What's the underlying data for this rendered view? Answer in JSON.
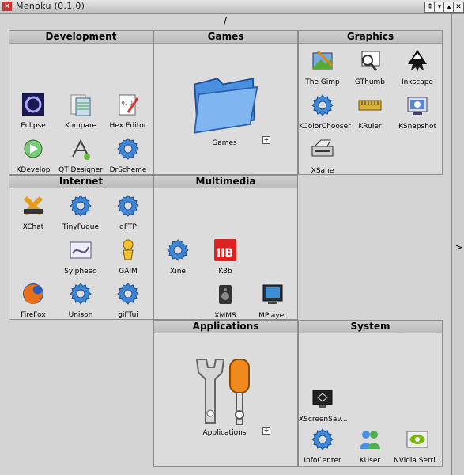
{
  "window": {
    "title": "Menoku (0.1.0)",
    "buttons": [
      "⇞",
      "▾",
      "▴",
      "✕"
    ]
  },
  "path": "/",
  "expand_label": "+",
  "side_toggle": ">",
  "panels": {
    "development": {
      "title": "Development",
      "items": [
        "Eclipse",
        "Kompare",
        "Hex Editor",
        "KDevelop",
        "QT Designer",
        "DrScheme"
      ]
    },
    "games": {
      "title": "Games",
      "items": [
        "Games"
      ]
    },
    "graphics": {
      "title": "Graphics",
      "items": [
        "The Gimp",
        "GThumb",
        "Inkscape",
        "KColorChooser",
        "KRuler",
        "KSnapshot",
        "XSane"
      ]
    },
    "internet": {
      "title": "Internet",
      "items": [
        "XChat",
        "TinyFugue",
        "gFTP",
        "Sylpheed",
        "GAIM",
        "FireFox",
        "Unison",
        "giFTui"
      ]
    },
    "multimedia": {
      "title": "Multimedia",
      "items": [
        "Xine",
        "K3b",
        "XMMS",
        "MPlayer"
      ]
    },
    "applications": {
      "title": "Applications",
      "items": [
        "Applications"
      ]
    },
    "system": {
      "title": "System",
      "items": [
        "XScreenSav...",
        "InfoCenter",
        "KUser",
        "NVidia Setti..."
      ]
    }
  },
  "icons": {
    "gear": "gear-icon",
    "folder": "folder-icon"
  }
}
